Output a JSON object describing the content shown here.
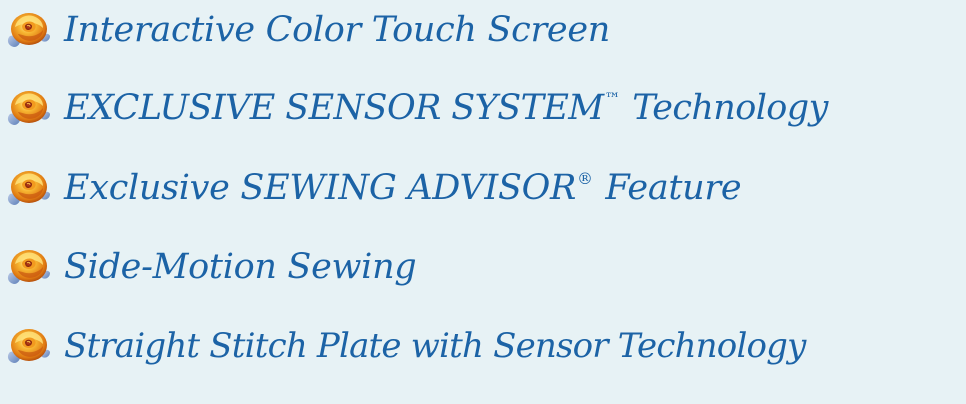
{
  "background_color": "#e7f2f5",
  "text_color": "#1c63a6",
  "bullet_icon": "rose-bullet-icon",
  "features": [
    {
      "text": "Interactive Color Touch Screen",
      "mark": "",
      "rest": ""
    },
    {
      "text": "EXCLUSIVE SENSOR SYSTEM",
      "mark": "™",
      "rest": " Technology"
    },
    {
      "text": "Exclusive SEWING ADVISOR",
      "mark": "®",
      "rest": " Feature"
    },
    {
      "text": "Side-Motion Sewing",
      "mark": "",
      "rest": ""
    },
    {
      "text": "Straight Stitch Plate with Sensor Technology",
      "mark": "",
      "rest": ""
    }
  ]
}
